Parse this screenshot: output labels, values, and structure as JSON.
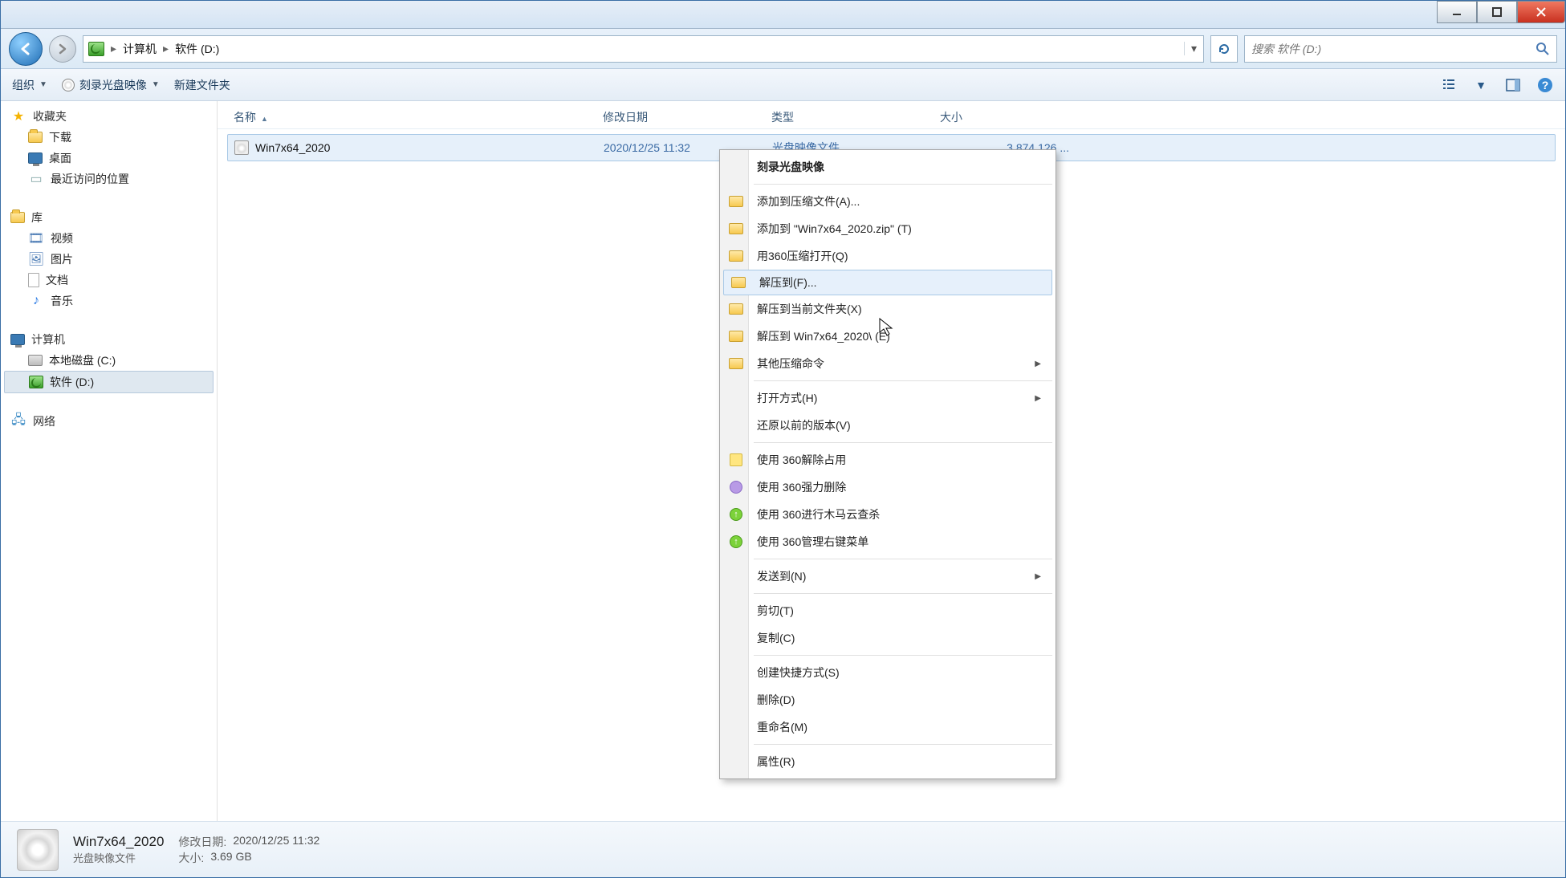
{
  "breadcrumb": {
    "seg1": "计算机",
    "seg2": "软件 (D:)"
  },
  "search": {
    "placeholder": "搜索 软件 (D:)"
  },
  "toolbar": {
    "organize": "组织",
    "burn": "刻录光盘映像",
    "newfolder": "新建文件夹"
  },
  "columns": {
    "name": "名称",
    "date": "修改日期",
    "type": "类型",
    "size": "大小"
  },
  "sidebar": {
    "favorites": "收藏夹",
    "downloads": "下载",
    "desktop": "桌面",
    "recent": "最近访问的位置",
    "libraries": "库",
    "videos": "视频",
    "pictures": "图片",
    "documents": "文档",
    "music": "音乐",
    "computer": "计算机",
    "localC": "本地磁盘 (C:)",
    "softD": "软件 (D:)",
    "network": "网络"
  },
  "file": {
    "name": "Win7x64_2020",
    "date": "2020/12/25 11:32",
    "type": "光盘映像文件",
    "size": "3,874,126 ..."
  },
  "ctx": {
    "burn": "刻录光盘映像",
    "addArchive": "添加到压缩文件(A)...",
    "addZip": "添加到 \"Win7x64_2020.zip\" (T)",
    "openWith360zip": "用360压缩打开(Q)",
    "extractTo": "解压到(F)...",
    "extractHere": "解压到当前文件夹(X)",
    "extractFolder": "解压到 Win7x64_2020\\ (E)",
    "otherZip": "其他压缩命令",
    "openWith": "打开方式(H)",
    "restorePrev": "还原以前的版本(V)",
    "unlock360": "使用 360解除占用",
    "forceDel360": "使用 360强力删除",
    "scan360": "使用 360进行木马云查杀",
    "manage360": "使用 360管理右键菜单",
    "sendTo": "发送到(N)",
    "cut": "剪切(T)",
    "copy": "复制(C)",
    "shortcut": "创建快捷方式(S)",
    "delete": "删除(D)",
    "rename": "重命名(M)",
    "properties": "属性(R)"
  },
  "details": {
    "title": "Win7x64_2020",
    "type": "光盘映像文件",
    "dateLabel": "修改日期:",
    "dateVal": "2020/12/25 11:32",
    "sizeLabel": "大小:",
    "sizeVal": "3.69 GB"
  }
}
